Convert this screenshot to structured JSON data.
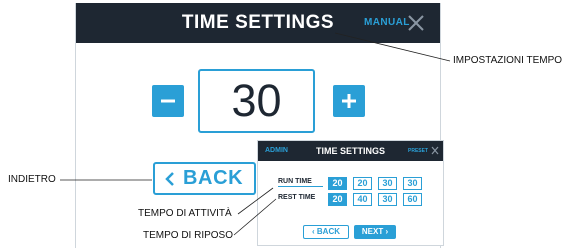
{
  "main_screen": {
    "title": "TIME SETTINGS",
    "mode": "MANUAL",
    "value": "30",
    "back_label": "BACK"
  },
  "inset_screen": {
    "admin_label": "ADMIN",
    "title": "TIME SETTINGS",
    "preset_label": "PRESET",
    "rows": [
      {
        "label": "RUN TIME",
        "values": [
          "20",
          "20",
          "30",
          "30"
        ],
        "selected_index": 0
      },
      {
        "label": "REST TIME",
        "values": [
          "20",
          "40",
          "30",
          "60"
        ],
        "selected_index": 0
      }
    ],
    "back_label": "BACK",
    "next_label": "NEXT"
  },
  "callouts": {
    "impostazioni_tempo": "IMPOSTAZIONI TEMPO",
    "indietro": "INDIETRO",
    "tempo_attivita": "TEMPO DI ATTIVITÀ",
    "tempo_riposo": "TEMPO DI RIPOSO"
  },
  "colors": {
    "accent": "#2a9fd6",
    "header": "#1e2732",
    "background": "#ffffff"
  },
  "icons": [
    "close-icon",
    "minus-icon",
    "plus-icon",
    "chevron-left-icon",
    "chevron-right-icon"
  ]
}
